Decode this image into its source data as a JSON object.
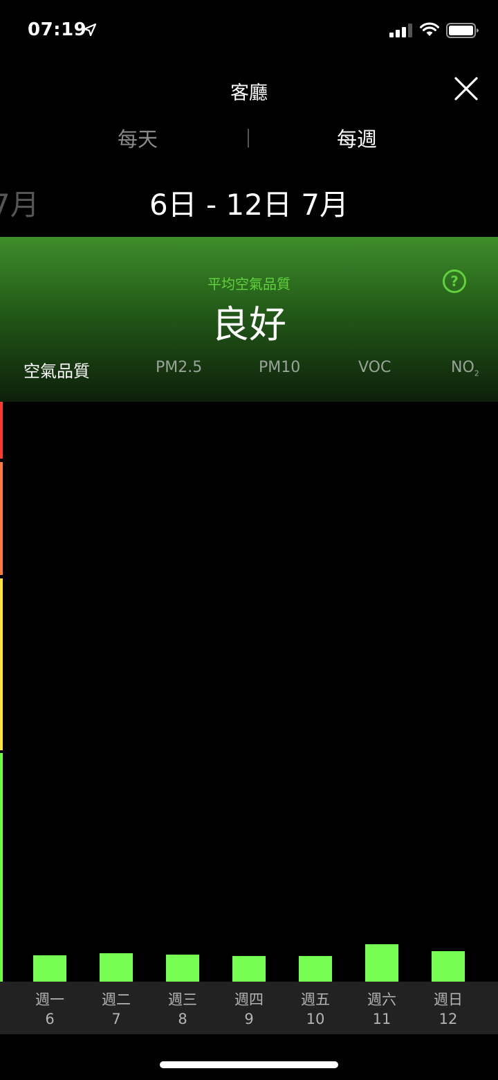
{
  "status": {
    "time": "07:19"
  },
  "header": {
    "title": "客廳"
  },
  "period_tabs": {
    "daily": "每天",
    "weekly": "每週",
    "selected": "weekly"
  },
  "date_range": {
    "previous_partial": "7月",
    "current": "6日 - 12日 7月"
  },
  "summary": {
    "subtitle": "平均空氣品質",
    "value": "良好"
  },
  "metric_tabs": [
    {
      "label": "空氣品質",
      "active": true
    },
    {
      "label": "PM2.5",
      "active": false
    },
    {
      "label": "PM10",
      "active": false
    },
    {
      "label": "VOC",
      "active": false
    },
    {
      "label": "NO",
      "sub": "2",
      "active": false
    }
  ],
  "colors": {
    "accent_green": "#5fd23c",
    "bar_green": "#76ff52",
    "scale": [
      "#ff3b30",
      "#ff7a3c",
      "#ffe53c",
      "#6cff4a"
    ]
  },
  "chart_data": {
    "type": "bar",
    "categories": [
      "週一 6",
      "週二 7",
      "週三 8",
      "週四 9",
      "週五 10",
      "週六 11",
      "週日 12"
    ],
    "values": [
      0.045,
      0.049,
      0.047,
      0.044,
      0.044,
      0.065,
      0.052
    ],
    "value_scale": "fraction of chart height (qualitative AQ scale, no numeric axis shown)"
  },
  "days": [
    {
      "name": "週一",
      "num": "6"
    },
    {
      "name": "週二",
      "num": "7"
    },
    {
      "name": "週三",
      "num": "8"
    },
    {
      "name": "週四",
      "num": "9"
    },
    {
      "name": "週五",
      "num": "10"
    },
    {
      "name": "週六",
      "num": "11"
    },
    {
      "name": "週日",
      "num": "12"
    }
  ]
}
